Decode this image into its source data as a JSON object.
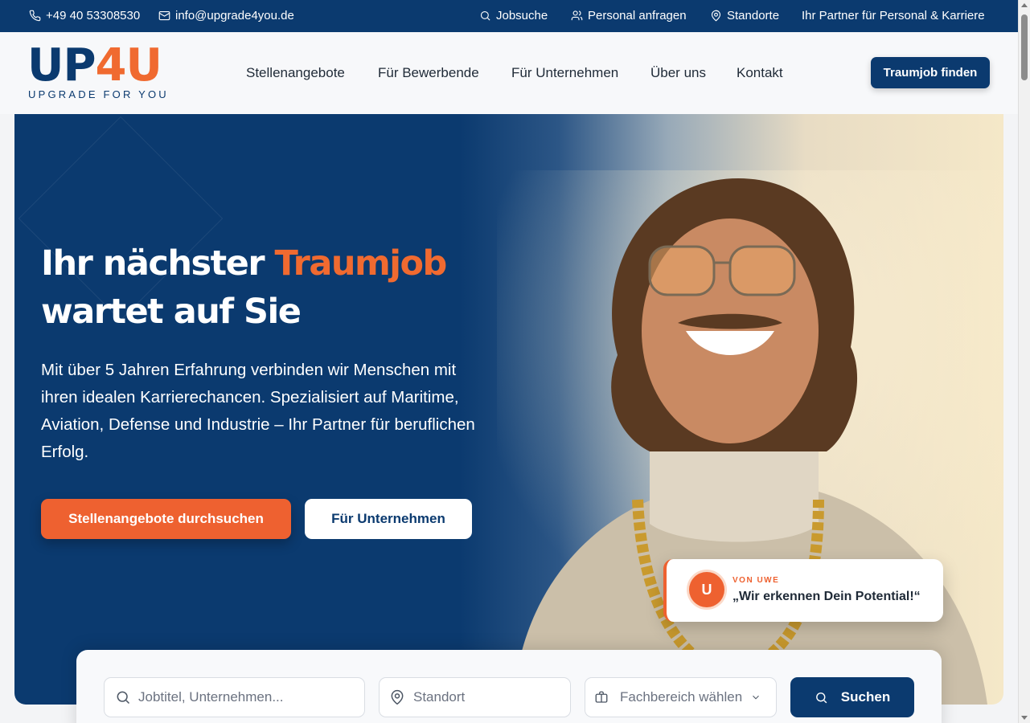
{
  "topbar": {
    "phone": "+49 40 53308530",
    "email": "info@upgrade4you.de",
    "links": [
      "Jobsuche",
      "Personal anfragen",
      "Standorte"
    ],
    "tagline": "Ihr Partner für Personal & Karriere"
  },
  "logo": {
    "part1": "UP",
    "part2": "4U",
    "tagline": "UPGRADE FOR YOU"
  },
  "nav": [
    "Stellenangebote",
    "Für Bewerbende",
    "Für Unternehmen",
    "Über uns",
    "Kontakt"
  ],
  "header_cta": "Traumjob finden",
  "hero": {
    "title_start": "Ihr nächster ",
    "title_accent": "Traumjob",
    "title_end": "wartet auf Sie",
    "lead": "Mit über 5 Jahren Erfahrung verbinden wir Menschen mit ihren idealen Karrierechancen. Spezialisiert auf Maritime, Aviation, Defense und Industrie – Ihr Partner für beruflichen Erfolg.",
    "btn_primary": "Stellenangebote durchsuchen",
    "btn_secondary": "Für Unternehmen"
  },
  "quote": {
    "avatar": "U",
    "from": "VON UWE",
    "text": "„Wir erkennen Dein Potential!“"
  },
  "search": {
    "keyword_placeholder": "Jobtitel, Unternehmen...",
    "location_placeholder": "Standort",
    "category_selected": "Fachbereich wählen",
    "submit": "Suchen"
  },
  "colors": {
    "navy": "#0b3a6f",
    "orange": "#ee6130"
  }
}
